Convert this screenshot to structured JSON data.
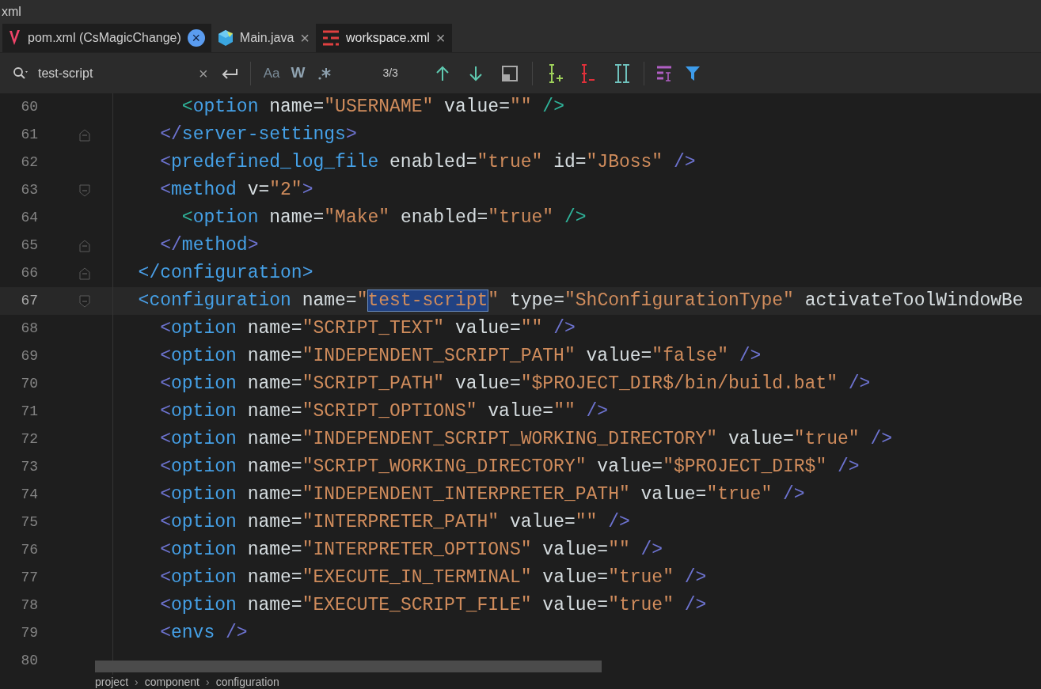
{
  "window": {
    "title": "xml"
  },
  "tabs": [
    {
      "label": "pom.xml (CsMagicChange)",
      "kind": "letter",
      "close": "×",
      "selected": false,
      "hovered": true
    },
    {
      "label": "Main.java",
      "kind": "cube",
      "close": "×",
      "selected": false,
      "hovered": false
    },
    {
      "label": "workspace.xml",
      "kind": "stripes",
      "close": "×",
      "selected": true,
      "hovered": false
    }
  ],
  "search": {
    "value": "test-script",
    "clear": "×",
    "match_case": "Aa",
    "words": "W",
    "count": "3/3"
  },
  "editor": {
    "lines": [
      {
        "number": "60",
        "kind": "plain",
        "current": false,
        "tokens": [
          {
            "kind": "inner",
            "text": "      <"
          },
          {
            "kind": "tag",
            "text": "option"
          },
          {
            "kind": "attr",
            "text": " name="
          },
          {
            "kind": "value",
            "text": "\"USERNAME\""
          },
          {
            "kind": "attr",
            "text": " value="
          },
          {
            "kind": "value",
            "text": "\"\""
          },
          {
            "kind": "inner",
            "text": " />"
          }
        ]
      },
      {
        "number": "61",
        "kind": "closer",
        "current": false,
        "tokens": [
          {
            "kind": "middle",
            "text": "    </"
          },
          {
            "kind": "tag",
            "text": "server-settings"
          },
          {
            "kind": "middle",
            "text": ">"
          }
        ]
      },
      {
        "number": "62",
        "kind": "plain",
        "current": false,
        "tokens": [
          {
            "kind": "middle",
            "text": "    <"
          },
          {
            "kind": "tag",
            "text": "predefined_log_file"
          },
          {
            "kind": "attr",
            "text": " enabled="
          },
          {
            "kind": "value",
            "text": "\"true\""
          },
          {
            "kind": "attr",
            "text": " id="
          },
          {
            "kind": "value",
            "text": "\"JBoss\""
          },
          {
            "kind": "middle",
            "text": " />"
          }
        ]
      },
      {
        "number": "63",
        "kind": "opener",
        "current": false,
        "tokens": [
          {
            "kind": "middle",
            "text": "    <"
          },
          {
            "kind": "tag",
            "text": "method"
          },
          {
            "kind": "attr",
            "text": " v="
          },
          {
            "kind": "value",
            "text": "\"2\""
          },
          {
            "kind": "middle",
            "text": ">"
          }
        ]
      },
      {
        "number": "64",
        "kind": "plain",
        "current": false,
        "tokens": [
          {
            "kind": "inner",
            "text": "      <"
          },
          {
            "kind": "tag",
            "text": "option"
          },
          {
            "kind": "attr",
            "text": " name="
          },
          {
            "kind": "value",
            "text": "\"Make\""
          },
          {
            "kind": "attr",
            "text": " enabled="
          },
          {
            "kind": "value",
            "text": "\"true\""
          },
          {
            "kind": "inner",
            "text": " />"
          }
        ]
      },
      {
        "number": "65",
        "kind": "closer",
        "current": false,
        "tokens": [
          {
            "kind": "middle",
            "text": "    </"
          },
          {
            "kind": "tag",
            "text": "method"
          },
          {
            "kind": "middle",
            "text": ">"
          }
        ]
      },
      {
        "number": "66",
        "kind": "closer",
        "current": false,
        "tokens": [
          {
            "kind": "outer",
            "text": "  </"
          },
          {
            "kind": "tag",
            "text": "configuration"
          },
          {
            "kind": "outer",
            "text": ">"
          }
        ]
      },
      {
        "number": "67",
        "kind": "opener",
        "current": true,
        "tokens": [
          {
            "kind": "outer",
            "text": "  <"
          },
          {
            "kind": "tag",
            "text": "configuration"
          },
          {
            "kind": "attr",
            "text": " name="
          },
          {
            "kind": "value",
            "text": "\""
          },
          {
            "kind": "match",
            "text": "test-script"
          },
          {
            "kind": "value",
            "text": "\""
          },
          {
            "kind": "attr",
            "text": " type="
          },
          {
            "kind": "value",
            "text": "\"ShConfigurationType\""
          },
          {
            "kind": "attr",
            "text": " activateToolWindowBe"
          }
        ]
      },
      {
        "number": "68",
        "kind": "plain",
        "current": false,
        "tokens": [
          {
            "kind": "middle",
            "text": "    <"
          },
          {
            "kind": "tag",
            "text": "option"
          },
          {
            "kind": "attr",
            "text": " name="
          },
          {
            "kind": "value",
            "text": "\"SCRIPT_TEXT\""
          },
          {
            "kind": "attr",
            "text": " value="
          },
          {
            "kind": "value",
            "text": "\"\""
          },
          {
            "kind": "middle",
            "text": " />"
          }
        ]
      },
      {
        "number": "69",
        "kind": "plain",
        "current": false,
        "tokens": [
          {
            "kind": "middle",
            "text": "    <"
          },
          {
            "kind": "tag",
            "text": "option"
          },
          {
            "kind": "attr",
            "text": " name="
          },
          {
            "kind": "value",
            "text": "\"INDEPENDENT_SCRIPT_PATH\""
          },
          {
            "kind": "attr",
            "text": " value="
          },
          {
            "kind": "value",
            "text": "\"false\""
          },
          {
            "kind": "middle",
            "text": " />"
          }
        ]
      },
      {
        "number": "70",
        "kind": "plain",
        "current": false,
        "tokens": [
          {
            "kind": "middle",
            "text": "    <"
          },
          {
            "kind": "tag",
            "text": "option"
          },
          {
            "kind": "attr",
            "text": " name="
          },
          {
            "kind": "value",
            "text": "\"SCRIPT_PATH\""
          },
          {
            "kind": "attr",
            "text": " value="
          },
          {
            "kind": "value",
            "text": "\"$PROJECT_DIR$/bin/build.bat\""
          },
          {
            "kind": "middle",
            "text": " />"
          }
        ]
      },
      {
        "number": "71",
        "kind": "plain",
        "current": false,
        "tokens": [
          {
            "kind": "middle",
            "text": "    <"
          },
          {
            "kind": "tag",
            "text": "option"
          },
          {
            "kind": "attr",
            "text": " name="
          },
          {
            "kind": "value",
            "text": "\"SCRIPT_OPTIONS\""
          },
          {
            "kind": "attr",
            "text": " value="
          },
          {
            "kind": "value",
            "text": "\"\""
          },
          {
            "kind": "middle",
            "text": " />"
          }
        ]
      },
      {
        "number": "72",
        "kind": "plain",
        "current": false,
        "tokens": [
          {
            "kind": "middle",
            "text": "    <"
          },
          {
            "kind": "tag",
            "text": "option"
          },
          {
            "kind": "attr",
            "text": " name="
          },
          {
            "kind": "value",
            "text": "\"INDEPENDENT_SCRIPT_WORKING_DIRECTORY\""
          },
          {
            "kind": "attr",
            "text": " value="
          },
          {
            "kind": "value",
            "text": "\"true\""
          },
          {
            "kind": "middle",
            "text": " />"
          }
        ]
      },
      {
        "number": "73",
        "kind": "plain",
        "current": false,
        "tokens": [
          {
            "kind": "middle",
            "text": "    <"
          },
          {
            "kind": "tag",
            "text": "option"
          },
          {
            "kind": "attr",
            "text": " name="
          },
          {
            "kind": "value",
            "text": "\"SCRIPT_WORKING_DIRECTORY\""
          },
          {
            "kind": "attr",
            "text": " value="
          },
          {
            "kind": "value",
            "text": "\"$PROJECT_DIR$\""
          },
          {
            "kind": "middle",
            "text": " />"
          }
        ]
      },
      {
        "number": "74",
        "kind": "plain",
        "current": false,
        "tokens": [
          {
            "kind": "middle",
            "text": "    <"
          },
          {
            "kind": "tag",
            "text": "option"
          },
          {
            "kind": "attr",
            "text": " name="
          },
          {
            "kind": "value",
            "text": "\"INDEPENDENT_INTERPRETER_PATH\""
          },
          {
            "kind": "attr",
            "text": " value="
          },
          {
            "kind": "value",
            "text": "\"true\""
          },
          {
            "kind": "middle",
            "text": " />"
          }
        ]
      },
      {
        "number": "75",
        "kind": "plain",
        "current": false,
        "tokens": [
          {
            "kind": "middle",
            "text": "    <"
          },
          {
            "kind": "tag",
            "text": "option"
          },
          {
            "kind": "attr",
            "text": " name="
          },
          {
            "kind": "value",
            "text": "\"INTERPRETER_PATH\""
          },
          {
            "kind": "attr",
            "text": " value="
          },
          {
            "kind": "value",
            "text": "\"\""
          },
          {
            "kind": "middle",
            "text": " />"
          }
        ]
      },
      {
        "number": "76",
        "kind": "plain",
        "current": false,
        "tokens": [
          {
            "kind": "middle",
            "text": "    <"
          },
          {
            "kind": "tag",
            "text": "option"
          },
          {
            "kind": "attr",
            "text": " name="
          },
          {
            "kind": "value",
            "text": "\"INTERPRETER_OPTIONS\""
          },
          {
            "kind": "attr",
            "text": " value="
          },
          {
            "kind": "value",
            "text": "\"\""
          },
          {
            "kind": "middle",
            "text": " />"
          }
        ]
      },
      {
        "number": "77",
        "kind": "plain",
        "current": false,
        "tokens": [
          {
            "kind": "middle",
            "text": "    <"
          },
          {
            "kind": "tag",
            "text": "option"
          },
          {
            "kind": "attr",
            "text": " name="
          },
          {
            "kind": "value",
            "text": "\"EXECUTE_IN_TERMINAL\""
          },
          {
            "kind": "attr",
            "text": " value="
          },
          {
            "kind": "value",
            "text": "\"true\""
          },
          {
            "kind": "middle",
            "text": " />"
          }
        ]
      },
      {
        "number": "78",
        "kind": "plain",
        "current": false,
        "tokens": [
          {
            "kind": "middle",
            "text": "    <"
          },
          {
            "kind": "tag",
            "text": "option"
          },
          {
            "kind": "attr",
            "text": " name="
          },
          {
            "kind": "value",
            "text": "\"EXECUTE_SCRIPT_FILE\""
          },
          {
            "kind": "attr",
            "text": " value="
          },
          {
            "kind": "value",
            "text": "\"true\""
          },
          {
            "kind": "middle",
            "text": " />"
          }
        ]
      },
      {
        "number": "79",
        "kind": "plain",
        "current": false,
        "tokens": [
          {
            "kind": "middle",
            "text": "    <"
          },
          {
            "kind": "tag",
            "text": "envs"
          },
          {
            "kind": "middle",
            "text": " />"
          }
        ]
      },
      {
        "number": "80",
        "kind": "plain",
        "current": false
      }
    ]
  },
  "breadcrumbs": [
    {
      "label": "project"
    },
    {
      "separator": "›",
      "label": "component"
    },
    {
      "separator": "›",
      "label": "configuration"
    }
  ]
}
